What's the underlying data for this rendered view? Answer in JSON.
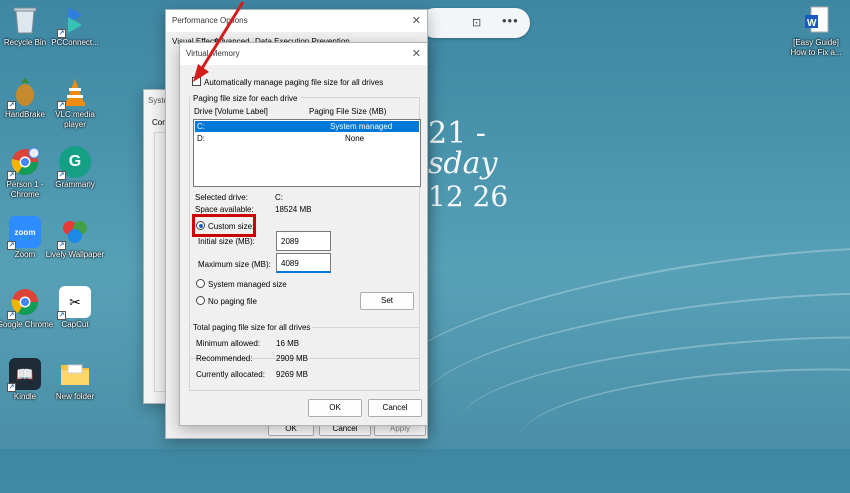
{
  "desktop": {
    "icons": [
      {
        "label": "Recycle Bin"
      },
      {
        "label": "PCConnect..."
      },
      {
        "label": "HandBrake"
      },
      {
        "label": "VLC media player"
      },
      {
        "label": "Person 1 - Chrome"
      },
      {
        "label": "Grammarly"
      },
      {
        "label": "Zoom"
      },
      {
        "label": "Lively Wallpaper"
      },
      {
        "label": "Google Chrome"
      },
      {
        "label": "CapCut"
      },
      {
        "label": "Kindle"
      },
      {
        "label": "New folder"
      },
      {
        "label": "[Easy Guide] How to Fix a..."
      }
    ],
    "clock": {
      "line1": "21 -",
      "line2": "sday",
      "line3": "12 26"
    }
  },
  "back_window": {
    "title": "Syste",
    "tab": "Com"
  },
  "perf_options": {
    "title": "Performance Options",
    "tabs": [
      "Visual Effects",
      "Advanced",
      "Data Execution Prevention"
    ],
    "buttons": {
      "ok": "OK",
      "cancel": "Cancel",
      "apply": "Apply"
    }
  },
  "virtual_memory": {
    "title": "Virtual Memory",
    "auto_manage_label": "Automatically manage paging file size for all drives",
    "auto_manage_checked": false,
    "group_title": "Paging file size for each drive",
    "list_headers": {
      "drive": "Drive  [Volume Label]",
      "size": "Paging File Size (MB)"
    },
    "drives": [
      {
        "drive": "C:",
        "size": "System managed",
        "selected": true
      },
      {
        "drive": "D:",
        "size": "None",
        "selected": false
      }
    ],
    "selected_drive_label": "Selected drive:",
    "selected_drive_value": "C:",
    "space_label": "Space available:",
    "space_value": "18524 MB",
    "custom_size_label": "Custom size:",
    "initial_label": "Initial size (MB):",
    "initial_value": "2089",
    "max_label": "Maximum size (MB):",
    "max_value": "4089",
    "system_managed_label": "System managed size",
    "no_paging_label": "No paging file",
    "set_button": "Set",
    "total_group_title": "Total paging file size for all drives",
    "min_allowed_label": "Minimum allowed:",
    "min_allowed_value": "16 MB",
    "recommended_label": "Recommended:",
    "recommended_value": "2909 MB",
    "allocated_label": "Currently allocated:",
    "allocated_value": "9269 MB",
    "ok_button": "OK",
    "cancel_button": "Cancel"
  },
  "colors": {
    "accent": "#0078d7",
    "highlight": "#cc0000",
    "selection": "#0078d7"
  }
}
